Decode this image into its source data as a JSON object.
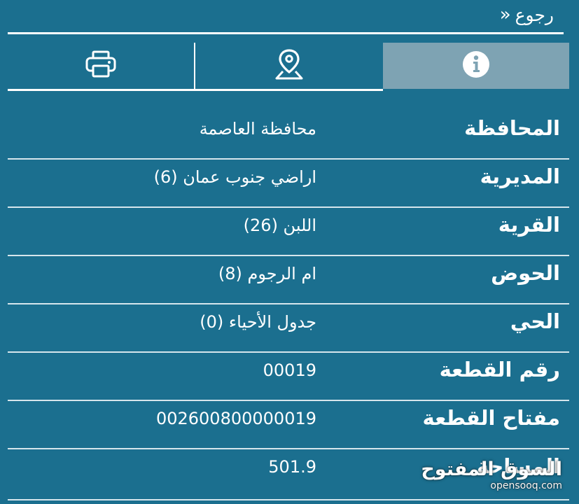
{
  "header": {
    "back_label": "رجوع",
    "back_icon": "double-chevron-left-icon"
  },
  "tabs": [
    {
      "name": "info",
      "icon": "info-icon",
      "active": true
    },
    {
      "name": "location",
      "icon": "map-pin-icon",
      "active": false
    },
    {
      "name": "print",
      "icon": "printer-icon",
      "active": false
    }
  ],
  "details": {
    "rows": [
      {
        "label": "المحافظة",
        "value": "محافظة العاصمة"
      },
      {
        "label": "المديرية",
        "value": "اراضي جنوب عمان (6)"
      },
      {
        "label": "القرية",
        "value": "اللبن (26)"
      },
      {
        "label": "الحوض",
        "value": "ام الرجوم (8)"
      },
      {
        "label": "الحي",
        "value": "جدول الأحياء (0)"
      },
      {
        "label": "رقم القطعة",
        "value": "00019"
      },
      {
        "label": "مفتاح القطعة",
        "value": "002600800000019"
      },
      {
        "label": "المساحة",
        "value": "501.9"
      }
    ]
  },
  "watermark": {
    "arabic": "السوق المفتوح",
    "latin": "opensooq.com"
  },
  "colors": {
    "background": "#1b6f8f",
    "active_tab": "#7ea3b3",
    "text": "#ffffff"
  }
}
